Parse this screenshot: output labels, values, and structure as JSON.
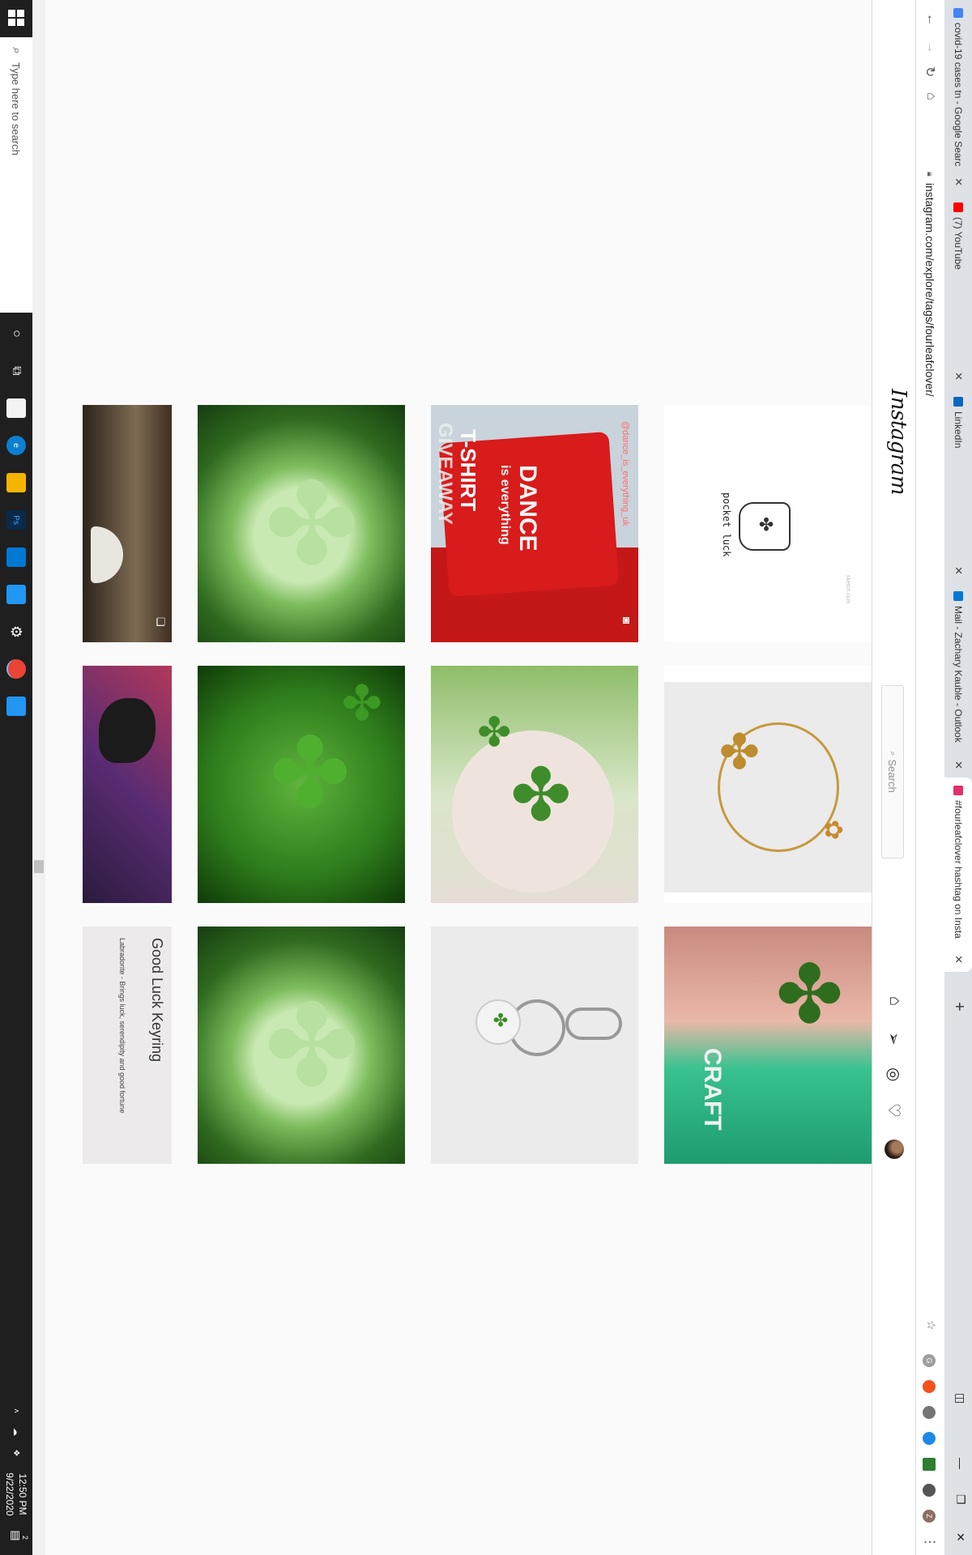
{
  "browser": {
    "tabs": [
      {
        "title": "covid-19 cases tn - Google Searc",
        "favicon_color": "#4285f4",
        "active": false
      },
      {
        "title": "(7) YouTube",
        "favicon_color": "#ff0000",
        "active": false
      },
      {
        "title": "LinkedIn",
        "favicon_color": "#0a66c2",
        "active": false
      },
      {
        "title": "Mail - Zachary Kauble - Outlook",
        "favicon_color": "#0078d4",
        "active": false
      },
      {
        "title": "#fourleafclover hashtag on Insta",
        "favicon_color": "#e1306c",
        "active": true
      }
    ],
    "new_tab_label": "+",
    "url": "instagram.com/explore/tags/fourleafclover/",
    "extensions": [
      {
        "letter": "Z",
        "color": "#8d6e63"
      },
      {
        "letter": "",
        "color": "#555"
      },
      {
        "letter": "",
        "color": "#2e7d32"
      },
      {
        "letter": "",
        "color": "#1e88e5"
      },
      {
        "letter": "",
        "color": "#757575"
      },
      {
        "letter": "",
        "color": "#f4511e"
      },
      {
        "letter": "G",
        "color": "#9e9e9e"
      }
    ]
  },
  "instagram": {
    "logo": "Instagram",
    "search_placeholder": "Search",
    "tiles": [
      {
        "kind": "text",
        "text": "pocket luck",
        "sub": "sketch.com"
      },
      {
        "kind": "tshirt",
        "line1": "DANCE",
        "line2": "is everything",
        "line3": "T-SHIRT",
        "line4": "GIVEAWAY",
        "handle": "@dance_is_everything_uk"
      },
      {
        "kind": "clover"
      },
      {
        "kind": "forest"
      },
      {
        "kind": "bracelet"
      },
      {
        "kind": "hand-clover"
      },
      {
        "kind": "clover-dark"
      },
      {
        "kind": "comic"
      },
      {
        "kind": "selfie",
        "text": "CRAFT"
      },
      {
        "kind": "keyring"
      },
      {
        "kind": "clover"
      },
      {
        "kind": "keyring-card",
        "title": "Good Luck Keyring",
        "subtitle": "Labradorite - Brings luck, serendipity and good fortune"
      }
    ]
  },
  "taskbar": {
    "search_placeholder": "Type here to search",
    "time": "12:50 PM",
    "date": "9/22/2020",
    "apps": [
      {
        "label": "",
        "color": "#ffffff"
      },
      {
        "label": "",
        "color": "#ffffff"
      },
      {
        "label": "e",
        "color": "#0c7fd1"
      },
      {
        "label": "",
        "color": "#f5b400"
      },
      {
        "label": "Ps",
        "color": "#0b2a4a"
      },
      {
        "label": "",
        "color": "#0078d4"
      },
      {
        "label": "",
        "color": "#2196f3"
      },
      {
        "label": "",
        "color": "#ffffff"
      },
      {
        "label": "",
        "color": "#e94335"
      },
      {
        "label": "",
        "color": "#2196f3"
      }
    ],
    "notification_count": "2"
  }
}
